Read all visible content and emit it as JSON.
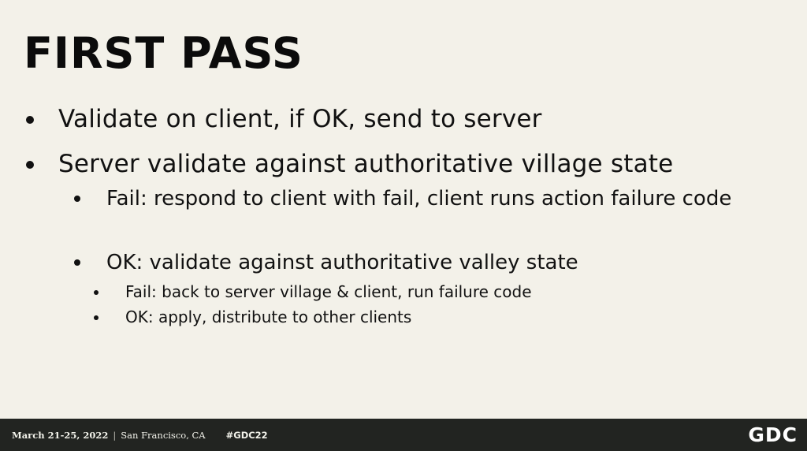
{
  "slide": {
    "title": "FIRST PASS",
    "bullets": [
      {
        "text": "Validate on client, if OK, send to server"
      },
      {
        "text": "Server validate against authoritative village state"
      },
      {
        "text": "Fail: respond to client with fail, client runs action failure code"
      },
      {
        "text": "OK: validate against authoritative valley state"
      },
      {
        "text": "Fail: back to server village & client, run failure code"
      },
      {
        "text": "OK: apply, distribute to other clients"
      }
    ]
  },
  "footer": {
    "date": "March 21-25, 2022",
    "separator": "|",
    "location": "San Francisco, CA",
    "hashtag": "#GDC22",
    "logo": "GDC"
  }
}
